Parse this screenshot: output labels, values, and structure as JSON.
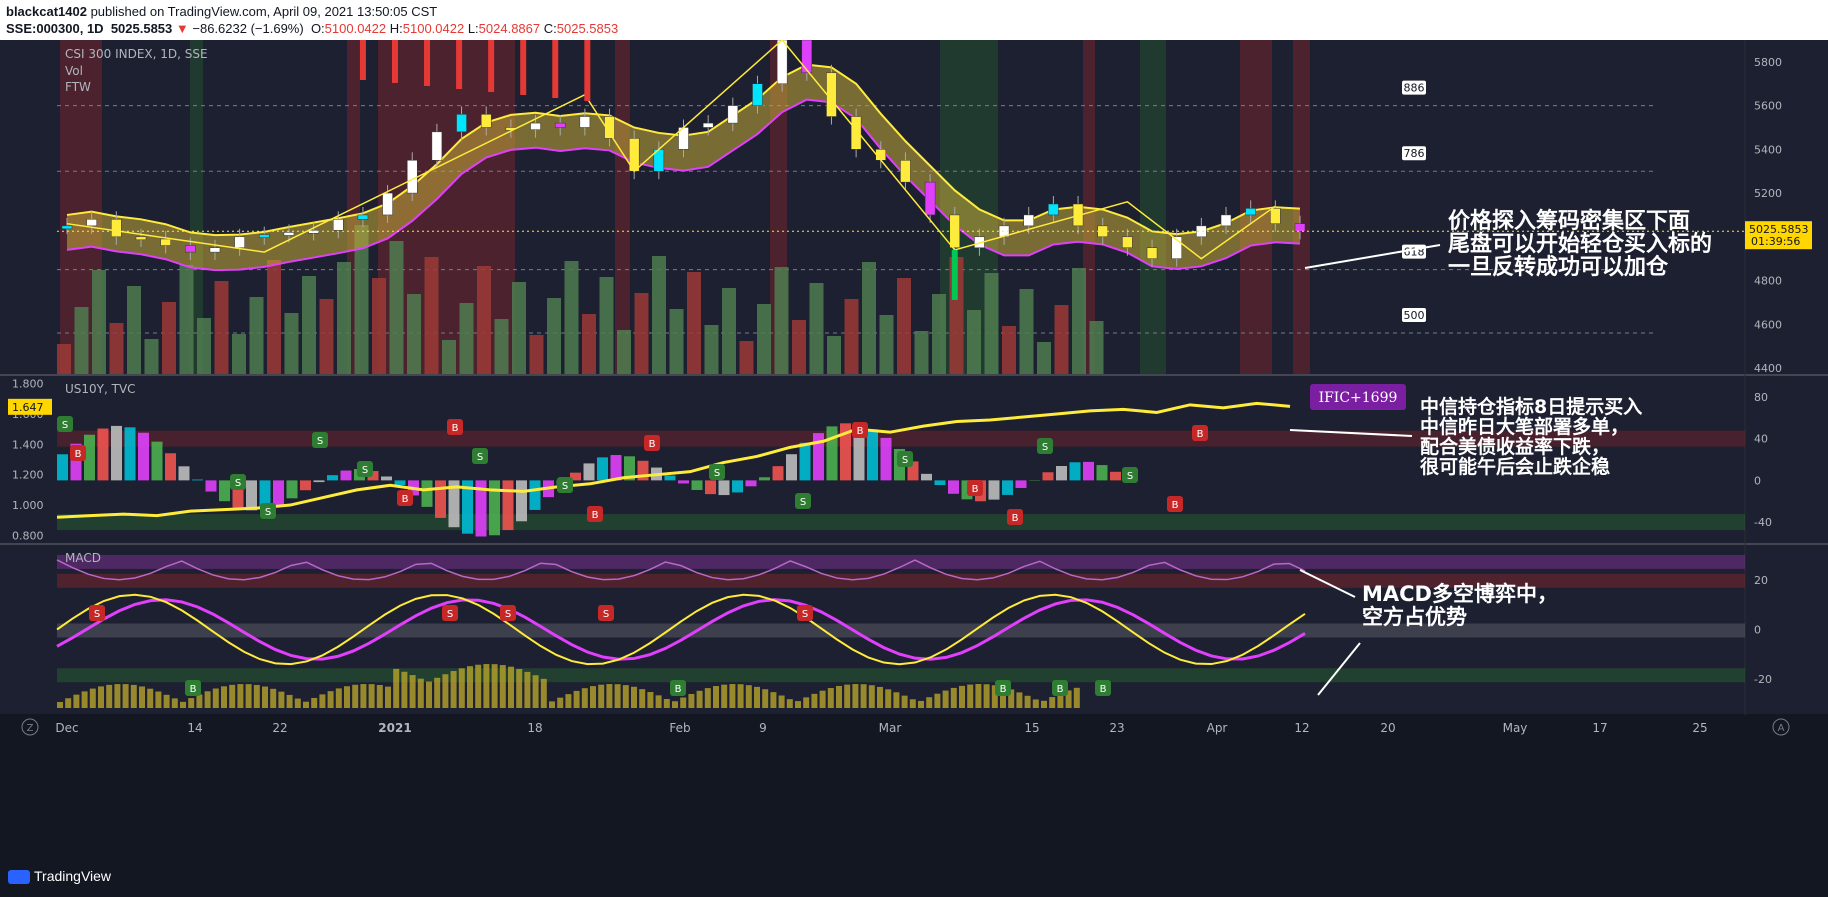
{
  "header": {
    "author": "blackcat1402",
    "published_text": " published on TradingView.com, April 09, 2021 13:50:05 CST",
    "symbol": "SSE:000300, 1D",
    "last_price": "5025.5853",
    "change": "−86.6232 (−1.69%)",
    "o_label": "O:",
    "o_value": "5100.0422",
    "h_label": "H:",
    "h_value": "5100.0422",
    "l_label": "L:",
    "l_value": "5024.8867",
    "c_label": "C:",
    "c_value": "5025.5853"
  },
  "footer": {
    "brand": "TradingView",
    "z_button": "Z",
    "a_button": "A"
  },
  "colors": {
    "bg": "#131722",
    "bull": "#26a69a",
    "bear": "#ef5350",
    "yellow": "#ffeb3b",
    "magenta": "#e040fb",
    "white": "#ffffff"
  },
  "chart_data": [
    {
      "type": "line",
      "title": "CSI 300 INDEX, 1D, SSE",
      "legend": [
        "Vol",
        "FTW"
      ],
      "y_ticks": [
        "5800",
        "5600",
        "5400",
        "5200",
        "4800",
        "4600",
        "4400"
      ],
      "ylim": [
        4400,
        5900
      ],
      "last_price_label": "5025.5853",
      "countdown_label": "01:39:56",
      "fib_labels": [
        "886",
        "786",
        "618",
        "500"
      ],
      "fib_levels": [
        5600,
        5300,
        4850,
        4560
      ],
      "x_ticks": [
        "Dec",
        "14",
        "22",
        "2021",
        "18",
        "Feb",
        "9",
        "Mar",
        "15",
        "23",
        "Apr",
        "12",
        "20",
        "May",
        "17",
        "25"
      ],
      "series": [
        {
          "name": "",
          "values": [
            5050,
            5080,
            5000,
            4990,
            4960,
            4930,
            4950,
            5000,
            5010,
            5020,
            5030,
            5080,
            5100,
            5200,
            5350,
            5480,
            5560,
            5500,
            5490,
            5520,
            5500,
            5550,
            5450,
            5300,
            5400,
            5500,
            5520,
            5600,
            5700,
            5900,
            5750,
            5550,
            5400,
            5350,
            5250,
            5100,
            4950,
            5000,
            5050,
            5100,
            5150,
            5050,
            5000,
            4950,
            4900,
            5000,
            5050,
            5100,
            5130,
            5060,
            5025
          ]
        }
      ],
      "annotation": [
        "价格探入筹码密集区下面",
        "尾盘可以开始轻仓买入标的",
        "一旦反转成功可以加仓"
      ]
    },
    {
      "type": "line",
      "title": "US10Y, TVC",
      "left_ticks": [
        "1.800",
        "1.600",
        "1.400",
        "1.200",
        "1.000",
        "0.800"
      ],
      "right_ticks": [
        "80",
        "40",
        "0",
        "-40"
      ],
      "current_label": "1.647",
      "tag": "IFIC+1699",
      "series": [
        {
          "name": "",
          "values": [
            0.92,
            0.93,
            0.94,
            0.93,
            0.96,
            0.97,
            0.98,
            1.0,
            1.05,
            1.1,
            1.13,
            1.1,
            1.12,
            1.1,
            1.09,
            1.12,
            1.14,
            1.18,
            1.2,
            1.22,
            1.28,
            1.32,
            1.38,
            1.42,
            1.5,
            1.48,
            1.52,
            1.55,
            1.56,
            1.58,
            1.6,
            1.62,
            1.63,
            1.61,
            1.66,
            1.64,
            1.67,
            1.65
          ]
        }
      ],
      "annotation": [
        "中信持仓指标8日提示买入",
        "中信昨日大笔部署多单，",
        "配合美债收益率下跌，",
        "很可能午后会止跌企稳"
      ]
    },
    {
      "type": "line",
      "title": "MACD",
      "right_ticks": [
        "20",
        "0",
        "-20"
      ],
      "annotation": [
        "MACD多空博弈中，",
        "空方占优势"
      ]
    }
  ]
}
